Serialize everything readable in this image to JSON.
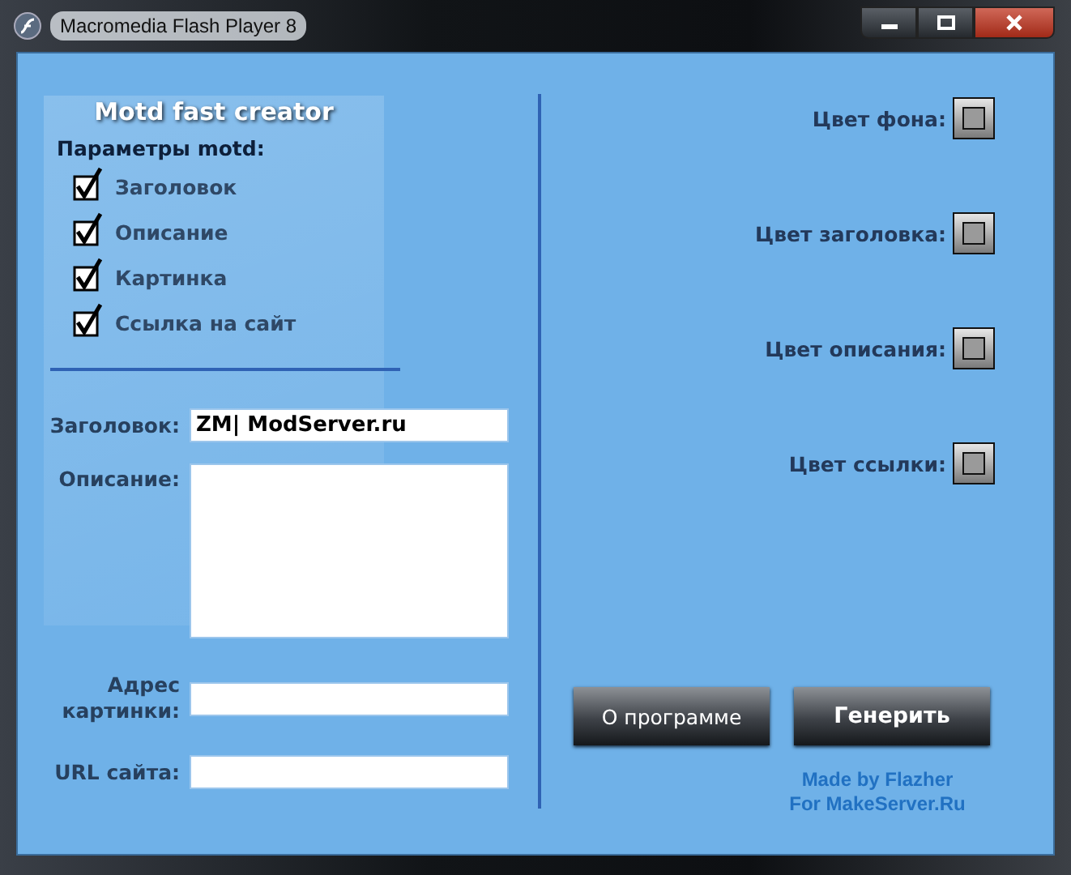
{
  "window": {
    "title": "Macromedia Flash Player 8"
  },
  "app_title": "Motd fast creator",
  "options_heading": "Параметры motd:",
  "options": [
    {
      "label": "Заголовок",
      "checked": true
    },
    {
      "label": "Описание",
      "checked": true
    },
    {
      "label": "Картинка",
      "checked": true
    },
    {
      "label": "Ссылка на сайт",
      "checked": true
    }
  ],
  "fields": [
    {
      "label": "Заголовок:",
      "value": "ZM| ModServer.ru",
      "kind": "line"
    },
    {
      "label": "Описание:",
      "kind": "area"
    },
    {
      "label": "Адрес картинки:",
      "kind": "line"
    },
    {
      "label": "URL сайта:",
      "kind": "line"
    }
  ],
  "color_pickers": [
    {
      "label": "Цвет фона:"
    },
    {
      "label": "Цвет заголовка:"
    },
    {
      "label": "Цвет описания:"
    },
    {
      "label": "Цвет ссылки:"
    }
  ],
  "buttons": [
    "О программе",
    "Генерить"
  ],
  "credits": [
    "Made by Flazher",
    "For MakeServer.Ru"
  ]
}
